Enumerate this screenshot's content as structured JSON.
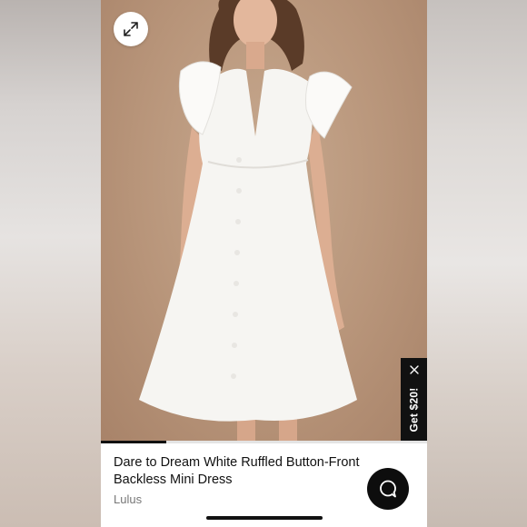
{
  "product": {
    "title": "Dare to Dream White Ruffled Button-Front Backless Mini Dress",
    "brand": "Lulus"
  },
  "promo": {
    "label": "Get $20!"
  },
  "gallery": {
    "progress": 0.2
  },
  "icons": {
    "expand": "expand-arrows-icon",
    "close": "close-icon",
    "chat": "chat-bubble-icon"
  },
  "colors": {
    "background": "#b8957a",
    "dress": "#f6f5f2",
    "accent": "#111111"
  }
}
